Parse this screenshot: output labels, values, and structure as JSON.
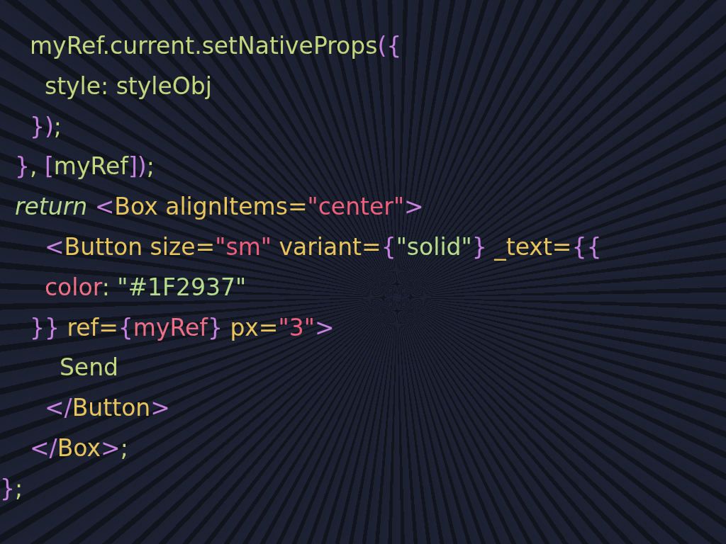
{
  "code_lines": [
    [
      {
        "text": "    myRef.current.setNativeProps",
        "kind": "plain"
      },
      {
        "text": "({",
        "kind": "punct"
      }
    ],
    [
      {
        "text": "      style: styleObj",
        "kind": "plain"
      }
    ],
    [
      {
        "text": "    })",
        "kind": "punct"
      },
      {
        "text": ";",
        "kind": "plain"
      }
    ],
    [
      {
        "text": "  }",
        "kind": "punct"
      },
      {
        "text": ", ",
        "kind": "plain"
      },
      {
        "text": "[",
        "kind": "punct"
      },
      {
        "text": "myRef",
        "kind": "plain"
      },
      {
        "text": "])",
        "kind": "punct"
      },
      {
        "text": ";",
        "kind": "plain"
      }
    ],
    [
      {
        "text": "  return",
        "kind": "keyword"
      },
      {
        "text": " <",
        "kind": "tag"
      },
      {
        "text": "Box alignItems=",
        "kind": "attr"
      },
      {
        "text": "\"center\"",
        "kind": "string"
      },
      {
        "text": ">",
        "kind": "tag"
      }
    ],
    [
      {
        "text": "      <",
        "kind": "tag"
      },
      {
        "text": "Button size=",
        "kind": "attr"
      },
      {
        "text": "\"sm\"",
        "kind": "string"
      },
      {
        "text": " variant=",
        "kind": "attr"
      },
      {
        "text": "{",
        "kind": "punct"
      },
      {
        "text": "\"solid\"",
        "kind": "string2"
      },
      {
        "text": "}",
        "kind": "punct"
      },
      {
        "text": " _text=",
        "kind": "attr"
      },
      {
        "text": "{{",
        "kind": "punct"
      }
    ],
    [
      {
        "text": "      color",
        "kind": "prop"
      },
      {
        "text": ": ",
        "kind": "plain"
      },
      {
        "text": "\"#1F2937\"",
        "kind": "string2"
      }
    ],
    [
      {
        "text": "    }}",
        "kind": "punct"
      },
      {
        "text": " ref=",
        "kind": "attr"
      },
      {
        "text": "{",
        "kind": "punct"
      },
      {
        "text": "myRef",
        "kind": "prop"
      },
      {
        "text": "}",
        "kind": "punct"
      },
      {
        "text": " px=",
        "kind": "attr"
      },
      {
        "text": "\"3\"",
        "kind": "string"
      },
      {
        "text": ">",
        "kind": "tag"
      }
    ],
    [
      {
        "text": "        Send",
        "kind": "plain"
      }
    ],
    [
      {
        "text": "      </",
        "kind": "tag"
      },
      {
        "text": "Button",
        "kind": "attr"
      },
      {
        "text": ">",
        "kind": "tag"
      }
    ],
    [
      {
        "text": "    </",
        "kind": "tag"
      },
      {
        "text": "Box",
        "kind": "attr"
      },
      {
        "text": ">",
        "kind": "tag"
      },
      {
        "text": ";",
        "kind": "plain"
      }
    ],
    [
      {
        "text": "}",
        "kind": "punct"
      },
      {
        "text": ";",
        "kind": "plain"
      }
    ]
  ]
}
